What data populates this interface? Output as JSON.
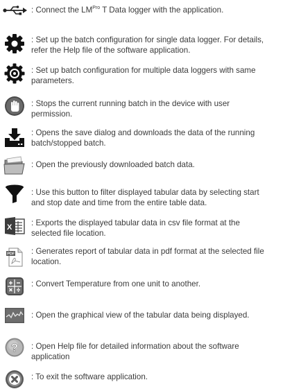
{
  "items": [
    {
      "icon": "usb-icon",
      "text_before": ": Connect the LM",
      "superscript": "Pro",
      "text_after": " T  Data logger with the application."
    },
    {
      "icon": "gear-icon",
      "text": ": Set up the batch configuration for single data logger. For details,\n refer the Help file of the software application."
    },
    {
      "icon": "multi-gear-icon",
      "text": ": Set up batch configuration for multiple data loggers with same\n parameters."
    },
    {
      "icon": "stop-hand-icon",
      "text": ": Stops the current running batch in the device with user\n permission."
    },
    {
      "icon": "download-icon",
      "text": ": Opens the save dialog and downloads the data of the running\n batch/stopped batch."
    },
    {
      "icon": "folder-open-icon",
      "text": ": Open the previously downloaded batch data."
    },
    {
      "icon": "filter-icon",
      "text": ": Use this button to filter displayed tabular data by selecting start\n and stop date and time from the entire table data."
    },
    {
      "icon": "excel-icon",
      "text": ": Exports the displayed tabular data in csv file format at the\n selected file location."
    },
    {
      "icon": "pdf-icon",
      "text": ": Generates report of tabular data in pdf format at the selected file\n location."
    },
    {
      "icon": "calculator-icon",
      "text": ": Convert Temperature from one unit to another."
    },
    {
      "icon": "graph-icon",
      "text": ": Open the graphical view of the tabular data being displayed."
    },
    {
      "icon": "help-icon",
      "text": ": Open Help file for detailed information about the software\n application"
    },
    {
      "icon": "exit-icon",
      "text": ": To exit the software application."
    }
  ]
}
